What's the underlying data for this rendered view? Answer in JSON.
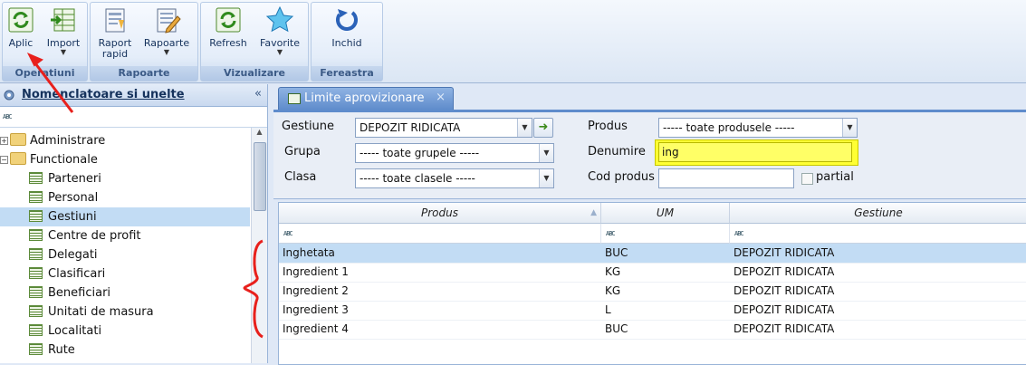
{
  "ribbon": {
    "groups": [
      {
        "title": "Operatiuni",
        "buttons": [
          {
            "label": "Aplic",
            "icon": "refresh-apply-icon"
          },
          {
            "label": "Import",
            "icon": "import-table-icon",
            "dropdown": true
          }
        ]
      },
      {
        "title": "Rapoarte",
        "buttons": [
          {
            "label": "Raport",
            "label2": "rapid",
            "icon": "quick-report-icon"
          },
          {
            "label": "Rapoarte",
            "icon": "reports-icon",
            "dropdown": true
          }
        ]
      },
      {
        "title": "Vizualizare",
        "buttons": [
          {
            "label": "Refresh",
            "icon": "refresh-icon"
          },
          {
            "label": "Favorite",
            "icon": "star-icon",
            "dropdown": true
          }
        ]
      },
      {
        "title": "Fereastra",
        "buttons": [
          {
            "label": "Inchid",
            "icon": "close-window-icon"
          }
        ]
      }
    ]
  },
  "left": {
    "title": "Nomenclatoare si unelte",
    "collapse_glyph": "«",
    "filter_abc": "ABC",
    "tree": [
      {
        "label": "Administrare",
        "type": "folder",
        "expander": "+"
      },
      {
        "label": "Functionale",
        "type": "folder",
        "expander": "−"
      },
      {
        "label": "Parteneri",
        "type": "item"
      },
      {
        "label": "Personal",
        "type": "item"
      },
      {
        "label": "Gestiuni",
        "type": "item",
        "selected": true
      },
      {
        "label": "Centre de profit",
        "type": "item"
      },
      {
        "label": "Delegati",
        "type": "item"
      },
      {
        "label": "Clasificari",
        "type": "item"
      },
      {
        "label": "Beneficiari",
        "type": "item"
      },
      {
        "label": "Unitati de masura",
        "type": "item"
      },
      {
        "label": "Localitati",
        "type": "item"
      },
      {
        "label": "Rute",
        "type": "item"
      }
    ]
  },
  "tab": {
    "label": "Limite aprovizionare",
    "close": "×"
  },
  "filters": {
    "gestiune": {
      "label": "Gestiune",
      "value": "DEPOZIT RIDICATA"
    },
    "grupa": {
      "label": "Grupa",
      "value": "----- toate grupele -----"
    },
    "clasa": {
      "label": "Clasa",
      "value": "----- toate clasele -----"
    },
    "produs": {
      "label": "Produs",
      "value": "----- toate produsele -----"
    },
    "denumire": {
      "label": "Denumire",
      "value": "ing"
    },
    "cod_produs": {
      "label": "Cod produs",
      "value": ""
    },
    "partial": {
      "label": "partial",
      "checked": false
    }
  },
  "grid": {
    "columns": [
      "Produs",
      "UM",
      "Gestiune"
    ],
    "filter_abc": "ABC",
    "rows": [
      {
        "produs": "Inghetata",
        "um": "BUC",
        "gestiune": "DEPOZIT RIDICATA",
        "selected": true
      },
      {
        "produs": "Ingredient 1",
        "um": "KG",
        "gestiune": "DEPOZIT RIDICATA"
      },
      {
        "produs": "Ingredient 2",
        "um": "KG",
        "gestiune": "DEPOZIT RIDICATA"
      },
      {
        "produs": "Ingredient 3",
        "um": "L",
        "gestiune": "DEPOZIT RIDICATA"
      },
      {
        "produs": "Ingredient 4",
        "um": "BUC",
        "gestiune": "DEPOZIT RIDICATA"
      }
    ]
  },
  "colors": {
    "annotation": "#e8201c",
    "highlight": "#ffff33",
    "selection": "#c2dcf4",
    "accent": "#5f8ccc"
  }
}
